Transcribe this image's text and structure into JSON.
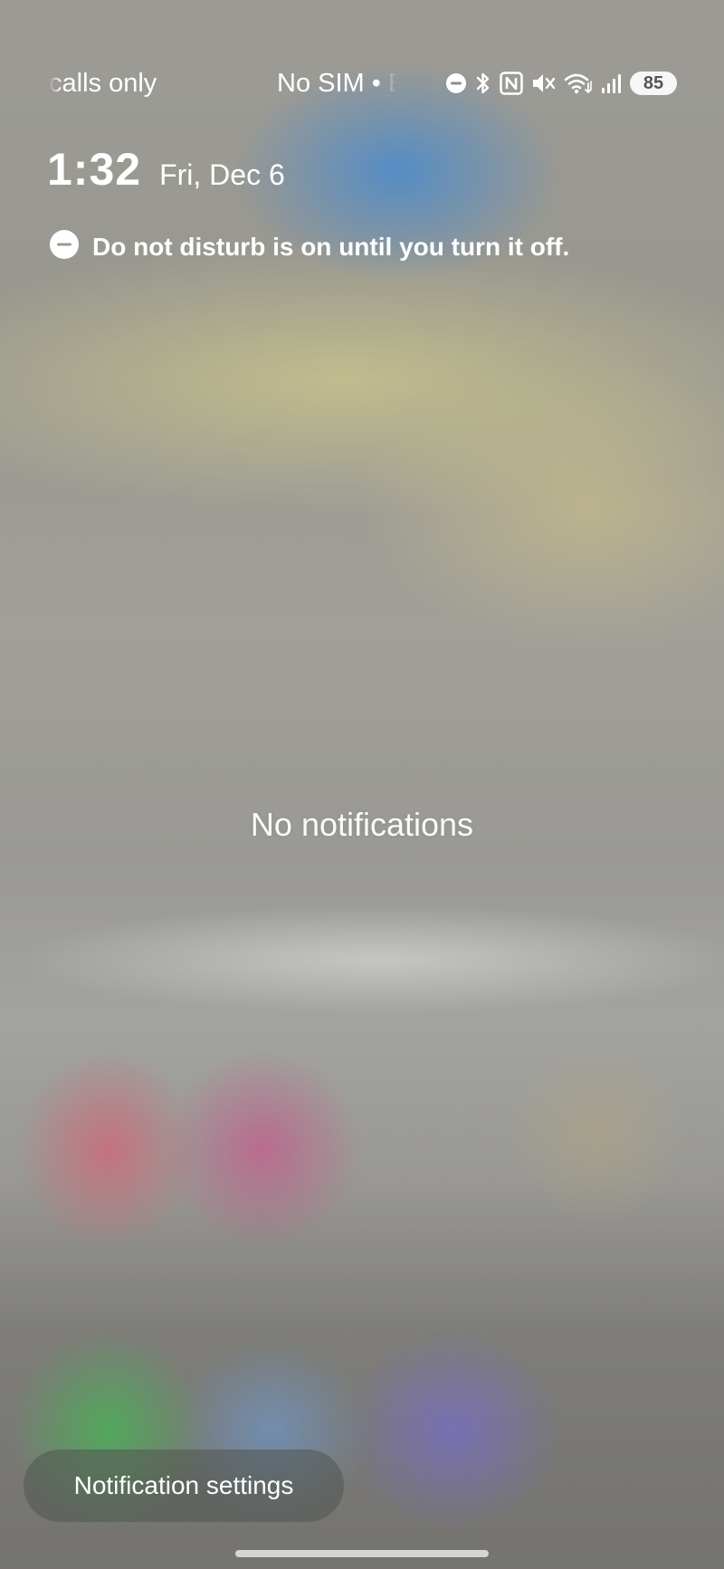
{
  "status_bar": {
    "carrier_left": "calls only",
    "carrier_center": "No SIM • E",
    "battery_level": "85",
    "icons": [
      "dnd-icon",
      "bluetooth-icon",
      "nfc-icon",
      "mute-icon",
      "wifi-icon",
      "signal-icon"
    ]
  },
  "clock": {
    "time": "1:32",
    "date": "Fri, Dec 6"
  },
  "dnd": {
    "message": "Do not disturb is on until you turn it off."
  },
  "notifications": {
    "empty_text": "No notifications"
  },
  "actions": {
    "settings_label": "Notification settings"
  }
}
